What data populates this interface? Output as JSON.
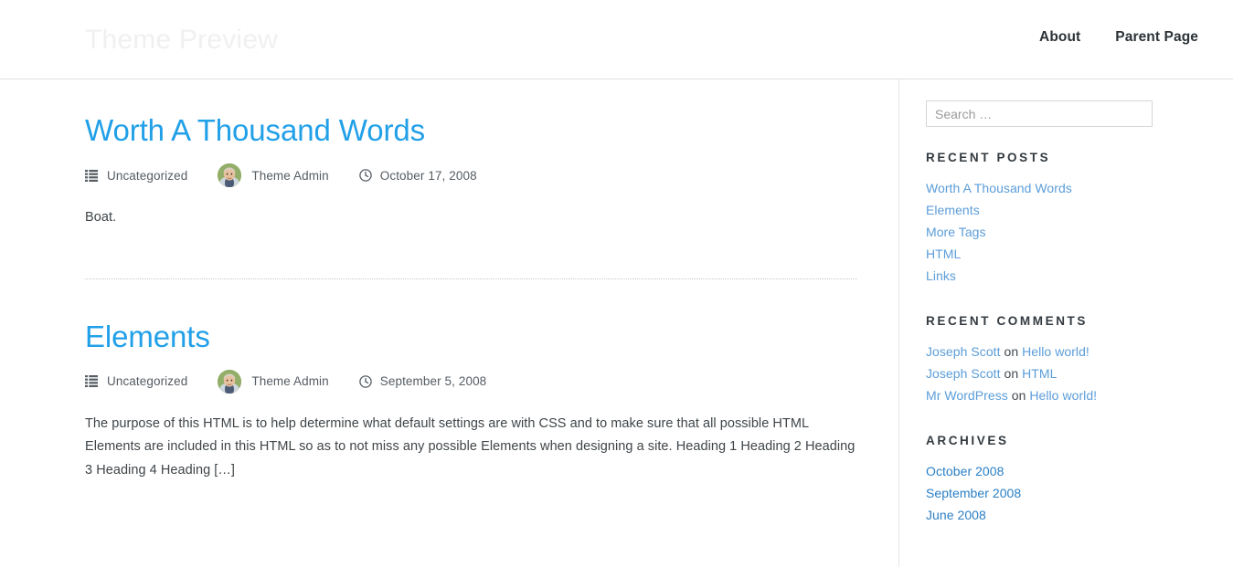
{
  "header": {
    "site_title": "Theme Preview",
    "nav": [
      {
        "label": "About"
      },
      {
        "label": "Parent Page"
      }
    ]
  },
  "main": {
    "posts": [
      {
        "title": "Worth A Thousand Words",
        "category_icon": "list-icon",
        "category": "Uncategorized",
        "author_avatar": "avatar-photo",
        "author": "Theme Admin",
        "date_icon": "clock-icon",
        "date": "October 17, 2008",
        "body": "Boat."
      },
      {
        "title": "Elements",
        "category_icon": "list-icon",
        "category": "Uncategorized",
        "author_avatar": "avatar-photo",
        "author": "Theme Admin",
        "date_icon": "clock-icon",
        "date": "September 5, 2008",
        "body": "The purpose of this HTML is to help determine what default settings are with CSS and to make sure that all possible HTML Elements are included in this HTML so as to not miss any possible Elements when designing a site. Heading 1 Heading 2 Heading 3 Heading 4 Heading […]"
      }
    ]
  },
  "sidebar": {
    "search": {
      "placeholder": "Search …",
      "value": "",
      "icon": "search-icon"
    },
    "recent_posts": {
      "title": "Recent Posts",
      "items": [
        {
          "label": "Worth A Thousand Words"
        },
        {
          "label": "Elements"
        },
        {
          "label": "More Tags"
        },
        {
          "label": "HTML"
        },
        {
          "label": "Links"
        }
      ]
    },
    "recent_comments": {
      "title": "Recent Comments",
      "separator": " on ",
      "items": [
        {
          "author": "Joseph Scott",
          "post": "Hello world!"
        },
        {
          "author": "Joseph Scott",
          "post": "HTML"
        },
        {
          "author": "Mr WordPress",
          "post": "Hello world!"
        }
      ]
    },
    "archives": {
      "title": "Archives",
      "items": [
        {
          "label": "October 2008"
        },
        {
          "label": "September 2008"
        },
        {
          "label": "June 2008"
        }
      ]
    }
  },
  "colors": {
    "post_title_link": "#21a0e8",
    "sidebar_link": "#5b9dd9",
    "archive_link": "#2a7fc4",
    "site_title": "#f0f0f0",
    "nav_text": "#2c3338",
    "body_text": "#3f4549",
    "meta_text": "#555c63",
    "border": "#e0e0e0"
  }
}
